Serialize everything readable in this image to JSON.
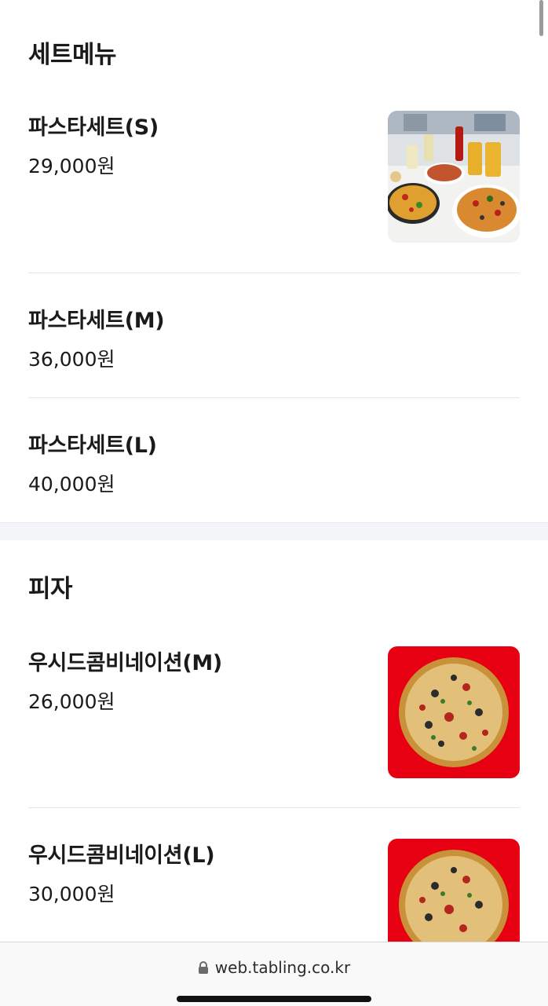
{
  "sections": [
    {
      "title": "세트메뉴",
      "items": [
        {
          "name": "파스타세트(S)",
          "price": "29,000원",
          "has_image": true,
          "image": "pasta-pizza-set-photo"
        },
        {
          "name": "파스타세트(M)",
          "price": "36,000원",
          "has_image": false
        },
        {
          "name": "파스타세트(L)",
          "price": "40,000원",
          "has_image": false
        }
      ]
    },
    {
      "title": "피자",
      "items": [
        {
          "name": "우시드콤비네이션(M)",
          "price": "26,000원",
          "has_image": true,
          "image": "combination-pizza-photo"
        },
        {
          "name": "우시드콤비네이션(L)",
          "price": "30,000원",
          "has_image": true,
          "image": "combination-pizza-photo"
        }
      ]
    }
  ],
  "browser": {
    "url": "web.tabling.co.kr",
    "url_icon": "lock-icon"
  },
  "colors": {
    "text": "#1a1a1a",
    "divider": "#e4e6ea",
    "section_gap": "#f4f5f8",
    "pizza_background": "#e60012"
  }
}
